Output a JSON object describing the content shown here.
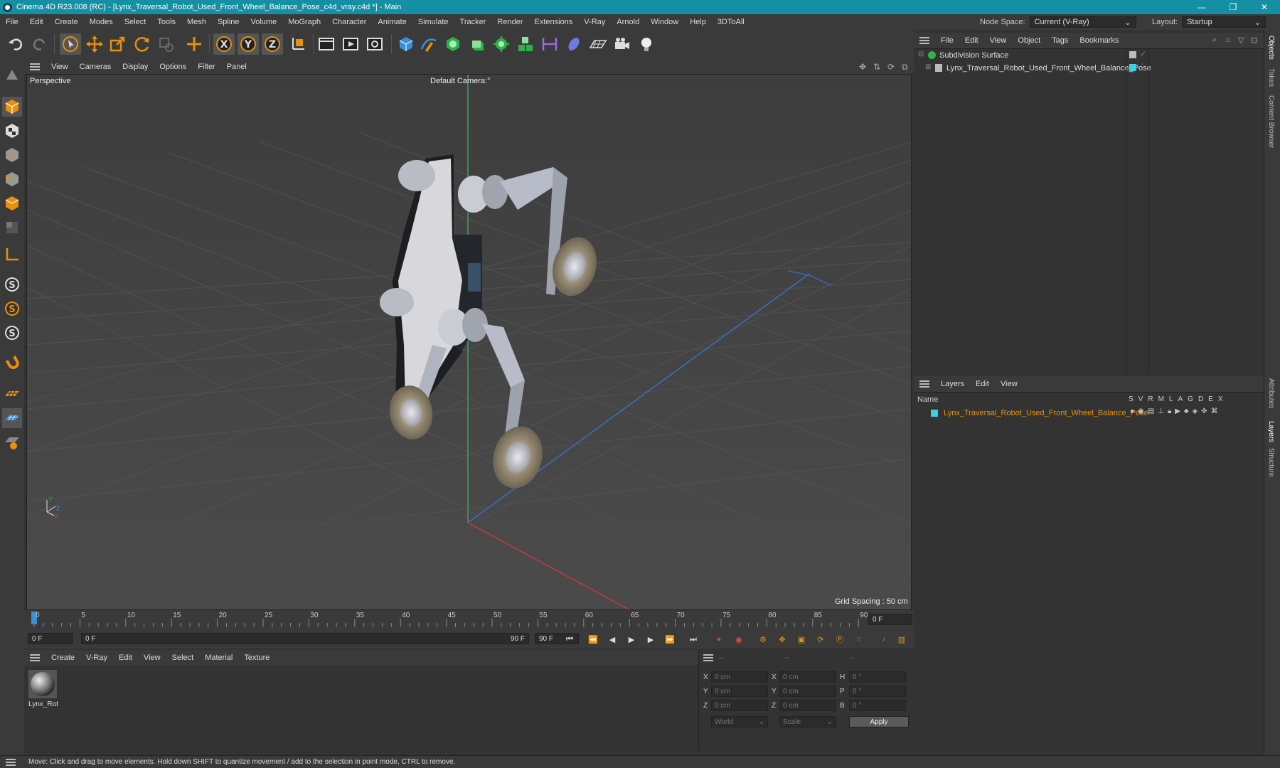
{
  "window": {
    "title": "Cinema 4D R23.008 (RC) - [Lynx_Traversal_Robot_Used_Front_Wheel_Balance_Pose_c4d_vray.c4d *] - Main",
    "minimize": "—",
    "maximize": "❐",
    "close": "✕"
  },
  "menubar": {
    "items": [
      "File",
      "Edit",
      "Create",
      "Modes",
      "Select",
      "Tools",
      "Mesh",
      "Spline",
      "Volume",
      "MoGraph",
      "Character",
      "Animate",
      "Simulate",
      "Tracker",
      "Render",
      "Extensions",
      "V-Ray",
      "Arnold",
      "Window",
      "Help",
      "3DToAll"
    ],
    "node_space_label": "Node Space:",
    "node_space_value": "Current (V-Ray)",
    "layout_label": "Layout:",
    "layout_value": "Startup"
  },
  "toolbar": {
    "icons": [
      "undo-icon",
      "redo-icon",
      "select-cursor-icon",
      "move-icon",
      "scale-icon",
      "rotate-icon",
      "recent-tool-icon",
      "add-tool-icon",
      "lock-x-icon",
      "lock-y-icon",
      "lock-z-icon",
      "coordinate-system-icon",
      "render-region-icon",
      "render-view-icon",
      "render-settings-icon",
      "cube-icon",
      "pen-spline-icon",
      "subdivision-icon",
      "extrude-icon",
      "cloner-icon",
      "array-icon",
      "deformer-icon",
      "field-icon",
      "floor-icon",
      "camera-icon",
      "light-icon"
    ],
    "x_label": "X",
    "y_label": "Y",
    "z_label": "Z"
  },
  "viewport": {
    "menu": [
      "View",
      "Cameras",
      "Display",
      "Options",
      "Filter",
      "Panel"
    ],
    "label": "Perspective",
    "camera": "Default Camera",
    "camera_suffix": ":°",
    "grid_spacing": "Grid Spacing : 50 cm",
    "axis_y": "Y",
    "axis_z": "Z",
    "axis_x": "X"
  },
  "timeline": {
    "ticks": [
      "0",
      "5",
      "10",
      "15",
      "20",
      "25",
      "30",
      "35",
      "40",
      "45",
      "50",
      "55",
      "60",
      "65",
      "70",
      "75",
      "80",
      "85",
      "90"
    ],
    "current_frame": "0 F",
    "start_field": "0 F",
    "range_start": "0 F",
    "range_end": "90 F",
    "end_field": "90 F"
  },
  "materials": {
    "menu": [
      "Create",
      "V-Ray",
      "Edit",
      "View",
      "Select",
      "Material",
      "Texture"
    ],
    "items": [
      {
        "name": "Lynx_Rot"
      }
    ]
  },
  "coordinates": {
    "headers": [
      "--",
      "--",
      "--"
    ],
    "rows": [
      {
        "l1": "X",
        "v1": "0 cm",
        "l2": "X",
        "v2": "0 cm",
        "l3": "H",
        "v3": "0 °"
      },
      {
        "l1": "Y",
        "v1": "0 cm",
        "l2": "Y",
        "v2": "0 cm",
        "l3": "P",
        "v3": "0 °"
      },
      {
        "l1": "Z",
        "v1": "0 cm",
        "l2": "Z",
        "v2": "0 cm",
        "l3": "B",
        "v3": "0 °"
      }
    ],
    "mode": "World",
    "size_mode": "Scale",
    "apply": "Apply"
  },
  "objects": {
    "menu": [
      "File",
      "Edit",
      "View",
      "Object",
      "Tags",
      "Bookmarks"
    ],
    "items": [
      {
        "name": "Subdivision Surface"
      },
      {
        "name": "Lynx_Traversal_Robot_Used_Front_Wheel_Balance_Pose"
      }
    ]
  },
  "layers": {
    "menu": [
      "Layers",
      "Edit",
      "View"
    ],
    "name_header": "Name",
    "flags": [
      "S",
      "V",
      "R",
      "M",
      "L",
      "A",
      "G",
      "D",
      "E",
      "X"
    ],
    "items": [
      {
        "name": "Lynx_Traversal_Robot_Used_Front_Wheel_Balance_Pose",
        "color": "#3fd0e0"
      }
    ]
  },
  "side_tabs": [
    "Objects",
    "Takes",
    "Content Browser",
    "Attributes",
    "Layers",
    "Structure"
  ],
  "status": "Move: Click and drag to move elements. Hold down SHIFT to quantize movement / add to the selection in point mode, CTRL to remove.",
  "colors": {
    "accent": "#158fa3",
    "orange": "#e8900c",
    "layer_text": "#e8900c",
    "cyan": "#3fd0e0"
  }
}
